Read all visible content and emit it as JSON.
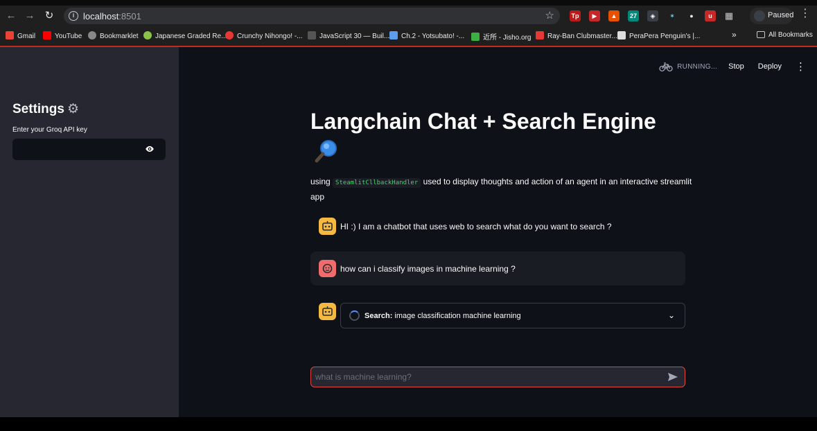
{
  "browser": {
    "url_host": "localhost",
    "url_port": ":8501",
    "profile_label": "Paused",
    "all_bookmarks_label": "All Bookmarks",
    "bookmarks": [
      {
        "label": "Gmail",
        "color": "#ea4335"
      },
      {
        "label": "YouTube",
        "color": "#ff0000"
      },
      {
        "label": "Bookmarklet",
        "color": "#888888"
      },
      {
        "label": "Japanese Graded Re...",
        "color": "#8bc34a"
      },
      {
        "label": "Crunchy Nihongo! -...",
        "color": "#e53935"
      },
      {
        "label": "JavaScript 30 — Buil...",
        "color": "#555555"
      },
      {
        "label": "Ch.2 - Yotsubato! -...",
        "color": "#5c9ded"
      },
      {
        "label": "近所 - Jisho.org",
        "color": "#3cb043"
      },
      {
        "label": "Ray-Ban Clubmaster...",
        "color": "#e53935"
      },
      {
        "label": "PeraPera Penguin's |...",
        "color": "#dddddd"
      }
    ]
  },
  "sidebar": {
    "title": "Settings",
    "api_label": "Enter your Groq API key",
    "api_value": ""
  },
  "header": {
    "running_label": "RUNNING...",
    "stop_label": "Stop",
    "deploy_label": "Deploy"
  },
  "main": {
    "title": "Langchain Chat + Search Engine",
    "subtitle_prefix": "using",
    "subtitle_code": "SteamlitCllbackHandler",
    "subtitle_suffix": "used to display thoughts and action of an agent in an interactive streamlit app",
    "messages": [
      {
        "role": "assistant",
        "text": "HI :) I am a chatbot that uses web to search what do you want to search ?"
      },
      {
        "role": "user",
        "text": "how can i classify images in machine learning ?"
      }
    ],
    "tool_step": {
      "label_bold": "Search:",
      "label_rest": "image classification machine learning"
    },
    "chat_placeholder": "what is machine learning?"
  },
  "colors": {
    "sidebar_bg": "#262730",
    "main_bg": "#0e1117",
    "bot_avatar": "#f5b942",
    "user_avatar": "#f06b6b",
    "input_border": "#e0443e"
  }
}
